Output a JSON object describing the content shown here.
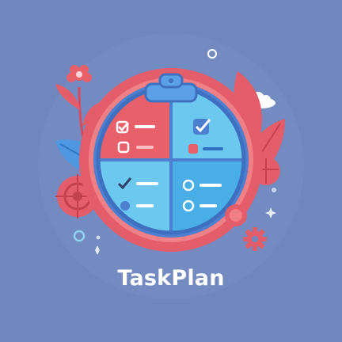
{
  "app": {
    "name": "TaskPlan"
  },
  "colors": {
    "background": "#6f87bd",
    "ring": "#e35d6a",
    "red_quadrant": "#e8606a",
    "blue_quadrant": "#4aaee6",
    "light_blue_quadrant": "#6cc8ef",
    "clipboard": "#5ba0e6",
    "leaf": "#4f97e0",
    "accent_red": "#d8495d"
  },
  "icons": [
    "clipboard-icon",
    "checkbox-checked-icon",
    "checkbox-empty-icon",
    "flower-icon",
    "leaf-icon",
    "target-icon",
    "gear-icon",
    "cloud-icon",
    "sparkle-icon"
  ]
}
